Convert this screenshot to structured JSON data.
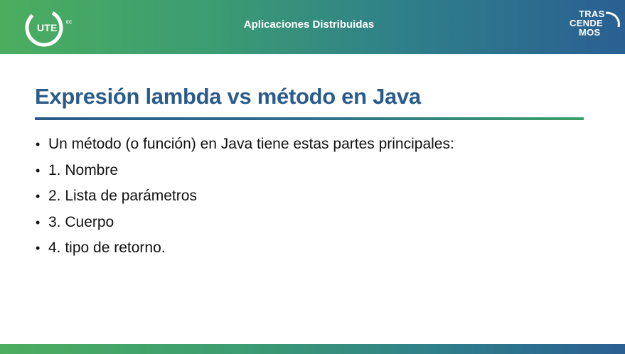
{
  "header": {
    "logo_text": "UTE",
    "logo_suffix": "EC",
    "title": "Aplicaciones Distribuidas",
    "brand_lines": [
      "TRAS",
      "CENDE",
      "MOS"
    ]
  },
  "slide": {
    "title": "Expresión lambda vs método en Java",
    "bullets": [
      "Un método (o función) en Java tiene estas partes principales:",
      "1. Nombre",
      "2. Lista de parámetros",
      "3. Cuerpo",
      "4. tipo de retorno."
    ],
    "bullet_glyph": "•"
  },
  "colors": {
    "header_gradient_start": "#4bae5f",
    "header_gradient_end": "#2a5f92",
    "title_color": "#2a5b8a",
    "text_color": "#111111"
  }
}
